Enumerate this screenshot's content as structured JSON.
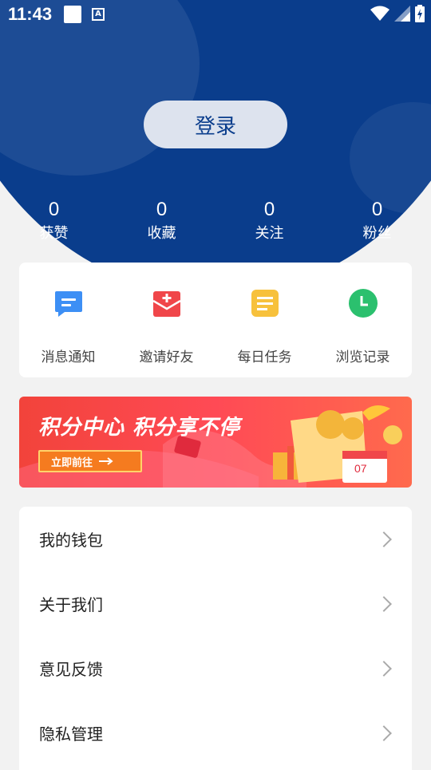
{
  "status_bar": {
    "time": "11:43",
    "a_icon_text": "A"
  },
  "header": {
    "login_label": "登录",
    "stats": [
      {
        "value": "0",
        "label": "获赞"
      },
      {
        "value": "0",
        "label": "收藏"
      },
      {
        "value": "0",
        "label": "关注"
      },
      {
        "value": "0",
        "label": "粉丝"
      }
    ]
  },
  "quick_actions": [
    {
      "label": "消息通知",
      "icon": "message-icon",
      "color": "#3d8ff5"
    },
    {
      "label": "邀请好友",
      "icon": "invite-envelope-icon",
      "color": "#f0464a"
    },
    {
      "label": "每日任务",
      "icon": "task-list-icon",
      "color": "#f7c13c"
    },
    {
      "label": "浏览记录",
      "icon": "history-clock-icon",
      "color": "#2bc06e"
    }
  ],
  "banner": {
    "title": "积分中心 积分享不停",
    "button_label": "立即前往",
    "calendar_day": "07"
  },
  "menu": [
    {
      "label": "我的钱包"
    },
    {
      "label": "关于我们"
    },
    {
      "label": "意见反馈"
    },
    {
      "label": "隐私管理"
    }
  ],
  "colors": {
    "primary": "#0a3d8c",
    "background": "#f2f2f2"
  }
}
